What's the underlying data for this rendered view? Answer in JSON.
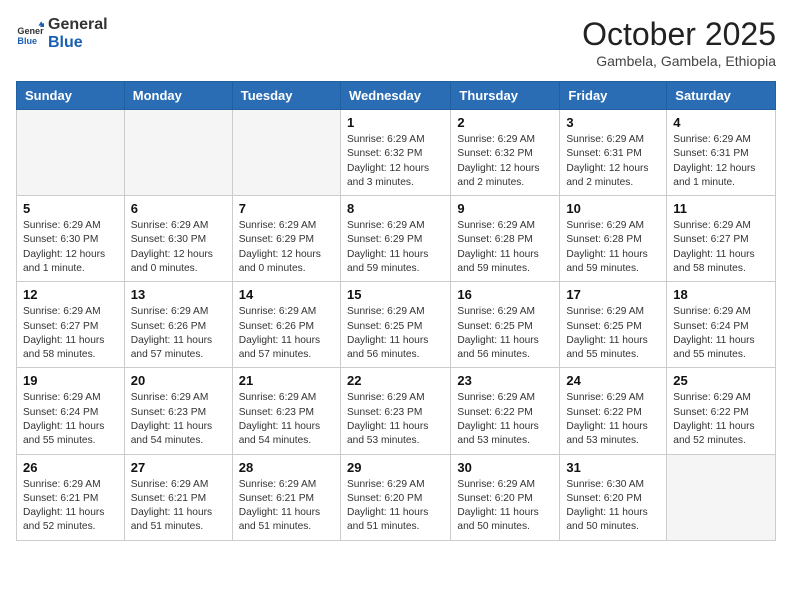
{
  "header": {
    "logo_general": "General",
    "logo_blue": "Blue",
    "month_title": "October 2025",
    "location": "Gambela, Gambela, Ethiopia"
  },
  "days_of_week": [
    "Sunday",
    "Monday",
    "Tuesday",
    "Wednesday",
    "Thursday",
    "Friday",
    "Saturday"
  ],
  "weeks": [
    [
      {
        "day": "",
        "empty": true
      },
      {
        "day": "",
        "empty": true
      },
      {
        "day": "",
        "empty": true
      },
      {
        "day": "1",
        "sunrise": "6:29 AM",
        "sunset": "6:32 PM",
        "daylight": "12 hours and 3 minutes."
      },
      {
        "day": "2",
        "sunrise": "6:29 AM",
        "sunset": "6:32 PM",
        "daylight": "12 hours and 2 minutes."
      },
      {
        "day": "3",
        "sunrise": "6:29 AM",
        "sunset": "6:31 PM",
        "daylight": "12 hours and 2 minutes."
      },
      {
        "day": "4",
        "sunrise": "6:29 AM",
        "sunset": "6:31 PM",
        "daylight": "12 hours and 1 minute."
      }
    ],
    [
      {
        "day": "5",
        "sunrise": "6:29 AM",
        "sunset": "6:30 PM",
        "daylight": "12 hours and 1 minute."
      },
      {
        "day": "6",
        "sunrise": "6:29 AM",
        "sunset": "6:30 PM",
        "daylight": "12 hours and 0 minutes."
      },
      {
        "day": "7",
        "sunrise": "6:29 AM",
        "sunset": "6:29 PM",
        "daylight": "12 hours and 0 minutes."
      },
      {
        "day": "8",
        "sunrise": "6:29 AM",
        "sunset": "6:29 PM",
        "daylight": "11 hours and 59 minutes."
      },
      {
        "day": "9",
        "sunrise": "6:29 AM",
        "sunset": "6:28 PM",
        "daylight": "11 hours and 59 minutes."
      },
      {
        "day": "10",
        "sunrise": "6:29 AM",
        "sunset": "6:28 PM",
        "daylight": "11 hours and 59 minutes."
      },
      {
        "day": "11",
        "sunrise": "6:29 AM",
        "sunset": "6:27 PM",
        "daylight": "11 hours and 58 minutes."
      }
    ],
    [
      {
        "day": "12",
        "sunrise": "6:29 AM",
        "sunset": "6:27 PM",
        "daylight": "11 hours and 58 minutes."
      },
      {
        "day": "13",
        "sunrise": "6:29 AM",
        "sunset": "6:26 PM",
        "daylight": "11 hours and 57 minutes."
      },
      {
        "day": "14",
        "sunrise": "6:29 AM",
        "sunset": "6:26 PM",
        "daylight": "11 hours and 57 minutes."
      },
      {
        "day": "15",
        "sunrise": "6:29 AM",
        "sunset": "6:25 PM",
        "daylight": "11 hours and 56 minutes."
      },
      {
        "day": "16",
        "sunrise": "6:29 AM",
        "sunset": "6:25 PM",
        "daylight": "11 hours and 56 minutes."
      },
      {
        "day": "17",
        "sunrise": "6:29 AM",
        "sunset": "6:25 PM",
        "daylight": "11 hours and 55 minutes."
      },
      {
        "day": "18",
        "sunrise": "6:29 AM",
        "sunset": "6:24 PM",
        "daylight": "11 hours and 55 minutes."
      }
    ],
    [
      {
        "day": "19",
        "sunrise": "6:29 AM",
        "sunset": "6:24 PM",
        "daylight": "11 hours and 55 minutes."
      },
      {
        "day": "20",
        "sunrise": "6:29 AM",
        "sunset": "6:23 PM",
        "daylight": "11 hours and 54 minutes."
      },
      {
        "day": "21",
        "sunrise": "6:29 AM",
        "sunset": "6:23 PM",
        "daylight": "11 hours and 54 minutes."
      },
      {
        "day": "22",
        "sunrise": "6:29 AM",
        "sunset": "6:23 PM",
        "daylight": "11 hours and 53 minutes."
      },
      {
        "day": "23",
        "sunrise": "6:29 AM",
        "sunset": "6:22 PM",
        "daylight": "11 hours and 53 minutes."
      },
      {
        "day": "24",
        "sunrise": "6:29 AM",
        "sunset": "6:22 PM",
        "daylight": "11 hours and 53 minutes."
      },
      {
        "day": "25",
        "sunrise": "6:29 AM",
        "sunset": "6:22 PM",
        "daylight": "11 hours and 52 minutes."
      }
    ],
    [
      {
        "day": "26",
        "sunrise": "6:29 AM",
        "sunset": "6:21 PM",
        "daylight": "11 hours and 52 minutes."
      },
      {
        "day": "27",
        "sunrise": "6:29 AM",
        "sunset": "6:21 PM",
        "daylight": "11 hours and 51 minutes."
      },
      {
        "day": "28",
        "sunrise": "6:29 AM",
        "sunset": "6:21 PM",
        "daylight": "11 hours and 51 minutes."
      },
      {
        "day": "29",
        "sunrise": "6:29 AM",
        "sunset": "6:20 PM",
        "daylight": "11 hours and 51 minutes."
      },
      {
        "day": "30",
        "sunrise": "6:29 AM",
        "sunset": "6:20 PM",
        "daylight": "11 hours and 50 minutes."
      },
      {
        "day": "31",
        "sunrise": "6:30 AM",
        "sunset": "6:20 PM",
        "daylight": "11 hours and 50 minutes."
      },
      {
        "day": "",
        "empty": true
      }
    ]
  ],
  "labels": {
    "sunrise": "Sunrise:",
    "sunset": "Sunset:",
    "daylight": "Daylight:"
  }
}
